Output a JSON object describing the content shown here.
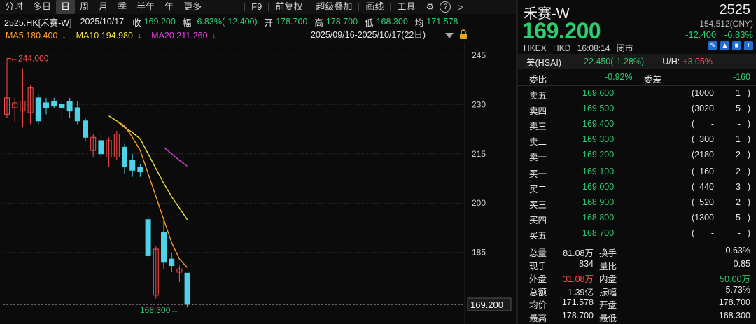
{
  "toolbar": {
    "items": [
      "分时",
      "多日",
      "日",
      "周",
      "月",
      "季",
      "半年",
      "年",
      "更多"
    ],
    "active_index": 2,
    "right_items": [
      "F9",
      "前复权",
      "超级叠加",
      "画线",
      "工具"
    ],
    "icons": [
      "gear-icon",
      "help-icon",
      "chevron-right-icon"
    ],
    "help_glyph": "?",
    "chevron_glyph": ">",
    "gear_glyph": "⚙"
  },
  "quote_line": {
    "symbol": "2525.HK[禾赛-W]",
    "date": "2025/10/17",
    "close_label": "收",
    "close": "169.200",
    "range_label": "幅",
    "change": "-6.83%(-12.400)",
    "open_label": "开",
    "open": "178.700",
    "high_label": "高",
    "high": "178.700",
    "low_label": "低",
    "low": "168.300",
    "avg_label": "均",
    "avg": "171.578"
  },
  "ma_line": {
    "ma5": "MA5 180.400",
    "ma10": "MA10 194.980",
    "ma20": "MA20 211.260",
    "ma5_arrow": "↓",
    "ma10_arrow": "↓",
    "ma20_arrow": "↓",
    "range_text": "2025/09/16-2025/10/17(22日)"
  },
  "colors": {
    "up": "#ff4d4d",
    "down": "#2ecc71",
    "ma5": "#ff9a2e",
    "ma10": "#f0e040",
    "ma20": "#e040e0",
    "candle_down": "#4fd2e8"
  },
  "chart_data": {
    "type": "candlestick",
    "ylim": [
      166,
      249
    ],
    "yticks": [
      245,
      230,
      215,
      200,
      185
    ],
    "last_price_label": "169.200",
    "max_label": "244.000",
    "min_label": "168.300",
    "candles": [
      {
        "o": 227.0,
        "h": 244.0,
        "l": 226.0,
        "c": 232.0
      },
      {
        "o": 229.0,
        "h": 232.0,
        "l": 224.5,
        "c": 230.5
      },
      {
        "o": 228.0,
        "h": 241.0,
        "l": 223.0,
        "c": 231.0
      },
      {
        "o": 227.5,
        "h": 236.0,
        "l": 224.0,
        "c": 235.0
      },
      {
        "o": 232.0,
        "h": 233.0,
        "l": 224.0,
        "c": 225.0
      },
      {
        "o": 230.5,
        "h": 232.0,
        "l": 227.0,
        "c": 229.0
      },
      {
        "o": 231.0,
        "h": 232.0,
        "l": 229.0,
        "c": 229.5
      },
      {
        "o": 230.0,
        "h": 231.0,
        "l": 226.0,
        "c": 229.0
      },
      {
        "o": 231.0,
        "h": 232.0,
        "l": 226.0,
        "c": 228.0
      },
      {
        "o": 229.0,
        "h": 231.0,
        "l": 224.0,
        "c": 225.0
      },
      {
        "o": 225.0,
        "h": 226.0,
        "l": 219.0,
        "c": 220.0
      },
      {
        "o": 216.0,
        "h": 221.0,
        "l": 214.0,
        "c": 220.0
      },
      {
        "o": 219.0,
        "h": 221.0,
        "l": 214.0,
        "c": 215.0
      },
      {
        "o": 214.0,
        "h": 220.0,
        "l": 211.0,
        "c": 219.0
      },
      {
        "o": 214.0,
        "h": 222.0,
        "l": 213.0,
        "c": 221.0
      },
      {
        "o": 217.0,
        "h": 218.0,
        "l": 209.0,
        "c": 211.0
      },
      {
        "o": 213.0,
        "h": 215.0,
        "l": 208.0,
        "c": 210.0
      },
      {
        "o": 211.0,
        "h": 212.0,
        "l": 208.0,
        "c": 209.5
      },
      {
        "o": 195.0,
        "h": 196.0,
        "l": 183.0,
        "c": 184.0
      },
      {
        "o": 172.0,
        "h": 187.0,
        "l": 171.0,
        "c": 186.0
      },
      {
        "o": 191.0,
        "h": 195.0,
        "l": 180.0,
        "c": 182.0
      },
      {
        "o": 183.0,
        "h": 185.0,
        "l": 179.0,
        "c": 181.0
      },
      {
        "o": 179.0,
        "h": 181.0,
        "l": 176.0,
        "c": 180.0
      },
      {
        "o": 178.7,
        "h": 178.7,
        "l": 168.3,
        "c": 169.2
      }
    ],
    "ma5": [
      null,
      null,
      null,
      null,
      null,
      null,
      null,
      null,
      null,
      null,
      null,
      null,
      null,
      null,
      225.0,
      223.5,
      220.0,
      216.0,
      209.0,
      202.0,
      195.0,
      188.0,
      183.0,
      180.4
    ],
    "ma10": [
      null,
      null,
      null,
      null,
      null,
      null,
      null,
      null,
      null,
      null,
      null,
      null,
      null,
      226.5,
      225.0,
      223.0,
      221.5,
      219.5,
      215.0,
      210.5,
      206.0,
      202.0,
      198.5,
      194.98
    ],
    "ma20": [
      null,
      null,
      null,
      null,
      null,
      null,
      null,
      null,
      null,
      null,
      null,
      null,
      null,
      null,
      null,
      null,
      null,
      null,
      null,
      null,
      217.0,
      215.0,
      213.0,
      211.26
    ]
  },
  "stock": {
    "name": "禾赛-W",
    "code": "2525",
    "price": "169.200",
    "cny": "154.512(CNY)",
    "change": "-12.400",
    "change_pct": "-6.83%",
    "exchange": "HKEX",
    "currency": "HKD",
    "time": "16:08:14",
    "status": "闭市",
    "mini_icons": [
      "edit-icon",
      "bell-icon",
      "pin-icon",
      "add-icon"
    ],
    "mini_glyphs": [
      "✎",
      "▲",
      "■",
      "+"
    ]
  },
  "hsai": {
    "label": "美(HSAI)",
    "value": "22.450(-1.28%)",
    "uh_label": "U/H:",
    "uh_value": "+3.05%"
  },
  "wei": {
    "bi_label": "委比",
    "bi": "-0.92%",
    "cha_label": "委差",
    "cha": "-160"
  },
  "order_book": {
    "asks": [
      {
        "label": "卖五",
        "price": "169.600",
        "vol": "1000",
        "cnt": "1"
      },
      {
        "label": "卖四",
        "price": "169.500",
        "vol": "3020",
        "cnt": "5"
      },
      {
        "label": "卖三",
        "price": "169.400",
        "vol": "-",
        "cnt": "-"
      },
      {
        "label": "卖二",
        "price": "169.300",
        "vol": "300",
        "cnt": "1"
      },
      {
        "label": "卖一",
        "price": "169.200",
        "vol": "2180",
        "cnt": "2"
      }
    ],
    "bids": [
      {
        "label": "买一",
        "price": "169.100",
        "vol": "160",
        "cnt": "2"
      },
      {
        "label": "买二",
        "price": "169.000",
        "vol": "440",
        "cnt": "3"
      },
      {
        "label": "买三",
        "price": "168.900",
        "vol": "520",
        "cnt": "2"
      },
      {
        "label": "买四",
        "price": "168.800",
        "vol": "1300",
        "cnt": "5"
      },
      {
        "label": "买五",
        "price": "168.700",
        "vol": "-",
        "cnt": "-"
      }
    ],
    "paren_open": "(",
    "paren_close": ")"
  },
  "stats": [
    {
      "l1": "总量",
      "v1": "81.08万",
      "l2": "换手",
      "v2": "0.63%",
      "c1": "wh",
      "c2": "wh"
    },
    {
      "l1": "现手",
      "v1": "834",
      "l2": "量比",
      "v2": "0.85",
      "c1": "wh",
      "c2": "wh"
    },
    {
      "l1": "外盘",
      "v1": "31.08万",
      "l2": "内盘",
      "v2": "50.00万",
      "c1": "up",
      "c2": "dn"
    },
    {
      "l1": "总额",
      "v1": "1.39亿",
      "l2": "振幅",
      "v2": "5.73%",
      "c1": "wh",
      "c2": "wh"
    },
    {
      "l1": "均价",
      "v1": "171.578",
      "l2": "开盘",
      "v2": "178.700",
      "c1": "wh",
      "c2": "wh"
    },
    {
      "l1": "最高",
      "v1": "178.700",
      "l2": "最低",
      "v2": "168.300",
      "c1": "wh",
      "c2": "wh"
    }
  ]
}
